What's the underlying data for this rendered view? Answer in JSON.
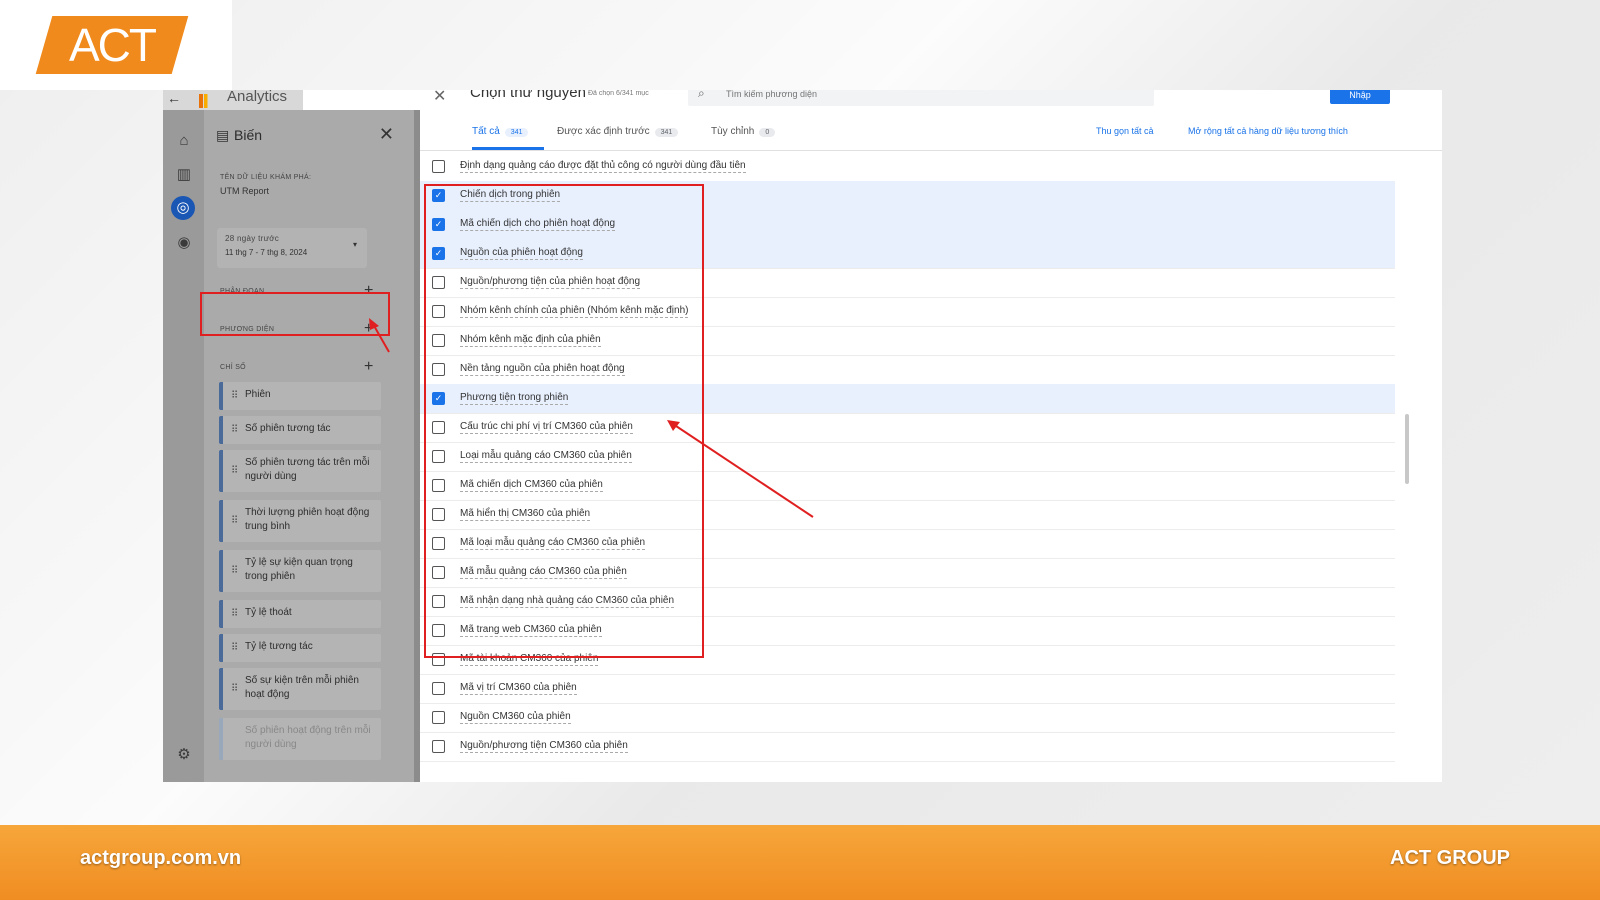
{
  "brand": {
    "logo": "ACT",
    "website": "actgroup.com.vn",
    "company": "ACT GROUP"
  },
  "app": {
    "name": "Analytics"
  },
  "panel": {
    "title": "Biến",
    "exploration_label": "TÊN DỮ LIỆU KHÁM PHÁ:",
    "exploration_name": "UTM Report",
    "date_range_label": "28 ngày trước",
    "date_range_value": "11 thg 7 - 7 thg 8, 2024",
    "segments_label": "PHÂN ĐOẠN",
    "dimensions_label": "PHƯƠNG DIỆN",
    "metrics_label": "CHỈ SỐ",
    "metrics": [
      "Phiên",
      "Số phiên tương tác",
      "Số phiên tương tác trên mỗi người dùng",
      "Thời lượng phiên hoạt động trung bình",
      "Tỷ lệ sự kiện quan trọng trong phiên",
      "Tỷ lệ thoát",
      "Tỷ lệ tương tác",
      "Số sự kiện trên mỗi phiên hoạt động",
      "Số phiên hoạt động trên mỗi người dùng"
    ]
  },
  "dialog": {
    "title": "Chọn thứ nguyên",
    "subtitle": "Đã chọn 6/341 mục",
    "search_placeholder": "Tìm kiếm phương diện",
    "apply_label": "Nhập",
    "tabs": [
      {
        "label": "Tất cả",
        "count": "341"
      },
      {
        "label": "Được xác định trước",
        "count": "341"
      },
      {
        "label": "Tùy chỉnh",
        "count": "0"
      }
    ],
    "collapse_all": "Thu gọn tất cả",
    "expand_all": "Mở rộng tất cả hàng dữ liệu tương thích",
    "rows": [
      {
        "label": "Định dạng quảng cáo được đặt thủ công có người dùng đầu tiên",
        "checked": false
      },
      {
        "label": "Chiến dịch trong phiên",
        "checked": true
      },
      {
        "label": "Mã chiến dịch cho phiên hoạt động",
        "checked": true
      },
      {
        "label": "Nguồn của phiên hoạt động",
        "checked": true
      },
      {
        "label": "Nguồn/phương tiện của phiên hoạt động",
        "checked": false
      },
      {
        "label": "Nhóm kênh chính của phiên (Nhóm kênh mặc định)",
        "checked": false
      },
      {
        "label": "Nhóm kênh mặc định của phiên",
        "checked": false
      },
      {
        "label": "Nền tảng nguồn của phiên hoạt động",
        "checked": false
      },
      {
        "label": "Phương tiện trong phiên",
        "checked": true
      },
      {
        "label": "Cấu trúc chi phí vị trí CM360 của phiên",
        "checked": false
      },
      {
        "label": "Loại mẫu quảng cáo CM360 của phiên",
        "checked": false
      },
      {
        "label": "Mã chiến dịch CM360 của phiên",
        "checked": false
      },
      {
        "label": "Mã hiển thị CM360 của phiên",
        "checked": false
      },
      {
        "label": "Mã loại mẫu quảng cáo CM360 của phiên",
        "checked": false
      },
      {
        "label": "Mã mẫu quảng cáo CM360 của phiên",
        "checked": false
      },
      {
        "label": "Mã nhận dạng nhà quảng cáo CM360 của phiên",
        "checked": false
      },
      {
        "label": "Mã trang web CM360 của phiên",
        "checked": false
      },
      {
        "label": "Mã tài khoản CM360 của phiên",
        "checked": false
      },
      {
        "label": "Mã vị trí CM360 của phiên",
        "checked": false
      },
      {
        "label": "Nguồn CM360 của phiên",
        "checked": false
      },
      {
        "label": "Nguồn/phương tiện CM360 của phiên",
        "checked": false
      }
    ]
  },
  "colors": {
    "accent": "#1a73e8",
    "brand": "#f08a1c",
    "annotation": "#e02020"
  }
}
